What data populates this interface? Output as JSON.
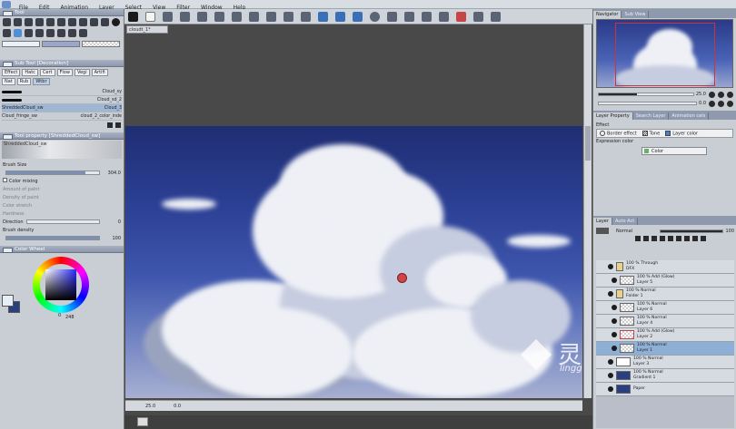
{
  "menu": [
    "File",
    "Edit",
    "Animation",
    "Layer",
    "Select",
    "View",
    "Filter",
    "Window",
    "Help"
  ],
  "left": {
    "tool_panel_title": "Tool",
    "subtool_panel_title": "Sub Tool [Decoration]",
    "subtabs": [
      "Effect",
      "Hatc",
      "Cert",
      "Flow",
      "Vegi",
      "Artifi",
      "Nat",
      "Rub",
      "Wtbr"
    ],
    "brushes": [
      {
        "name": "Cloud_sy"
      },
      {
        "name": "Cloud_sd_2"
      },
      {
        "name": "ShreddedCloud_sw"
      },
      {
        "name": "Cloud_3"
      },
      {
        "name": "Cloud_fringe_sw"
      },
      {
        "name": "cloud_2_color_inde"
      }
    ],
    "tool_property_title": "Tool property [ShreddedCloud_sw]",
    "preview_label": "ShreddedCloud_sw",
    "props": {
      "brush_size_label": "Brush Size",
      "brush_size_value": "304.0",
      "color_mixing_label": "Color mixing",
      "amount_paint_label": "Amount of paint",
      "density_paint_label": "Density of paint",
      "color_stretch_label": "Color stretch",
      "hardness_label": "Hardness",
      "direction_label": "Direction",
      "direction_value": "0",
      "brush_density_label": "Brush density",
      "brush_density_value": "100"
    },
    "color_wheel_title": "Color Wheel",
    "color_value_a": "0",
    "color_value_b": "248"
  },
  "canvas": {
    "doc_tab": "cloudt_1*",
    "zoom": "25.0",
    "angle": "0.0"
  },
  "right": {
    "nav_tabs": [
      "Navigator",
      "Sub View"
    ],
    "nav_zoom": "25.0",
    "nav_angle": "0.0",
    "layer_prop_tabs": [
      "Layer Property",
      "Search Layer",
      "Animation cels"
    ],
    "effect_label": "Effect",
    "border_effect_label": "Border effect",
    "tone_label": "Tone",
    "layer_color_label": "Layer color",
    "expression_color_label": "Expression color",
    "color_select": "Color",
    "layer_tabs": [
      "Layer",
      "Auto Act"
    ],
    "blend_mode": "Normal",
    "opacity": "100",
    "layers": [
      {
        "line1": "100 % Through",
        "line2": "DFX",
        "type": "folder"
      },
      {
        "line1": "100 % Add (Glow)",
        "line2": "Layer 5",
        "type": "raster"
      },
      {
        "line1": "100 % Normal",
        "line2": "Folder 1",
        "type": "folder"
      },
      {
        "line1": "100 % Normal",
        "line2": "Layer 6",
        "type": "raster"
      },
      {
        "line1": "100 % Normal",
        "line2": "Layer 4",
        "type": "raster"
      },
      {
        "line1": "100 % Add (Glow)",
        "line2": "Layer 2",
        "type": "raster"
      },
      {
        "line1": "100 % Normal",
        "line2": "Layer 1",
        "type": "raster",
        "selected": true
      },
      {
        "line1": "100 % Normal",
        "line2": "Layer 3",
        "type": "white"
      },
      {
        "line1": "100 % Normal",
        "line2": "Gradient 1",
        "type": "gradient"
      },
      {
        "line1": "",
        "line2": "Paper",
        "type": "paper"
      }
    ]
  },
  "watermark": {
    "cn_text": "灵感中国",
    "domain_text": "lingganchina.com"
  },
  "colors": {
    "accent": "#4f8fd6",
    "sky_top": "#1f2d72",
    "cursor": "#d04545"
  }
}
